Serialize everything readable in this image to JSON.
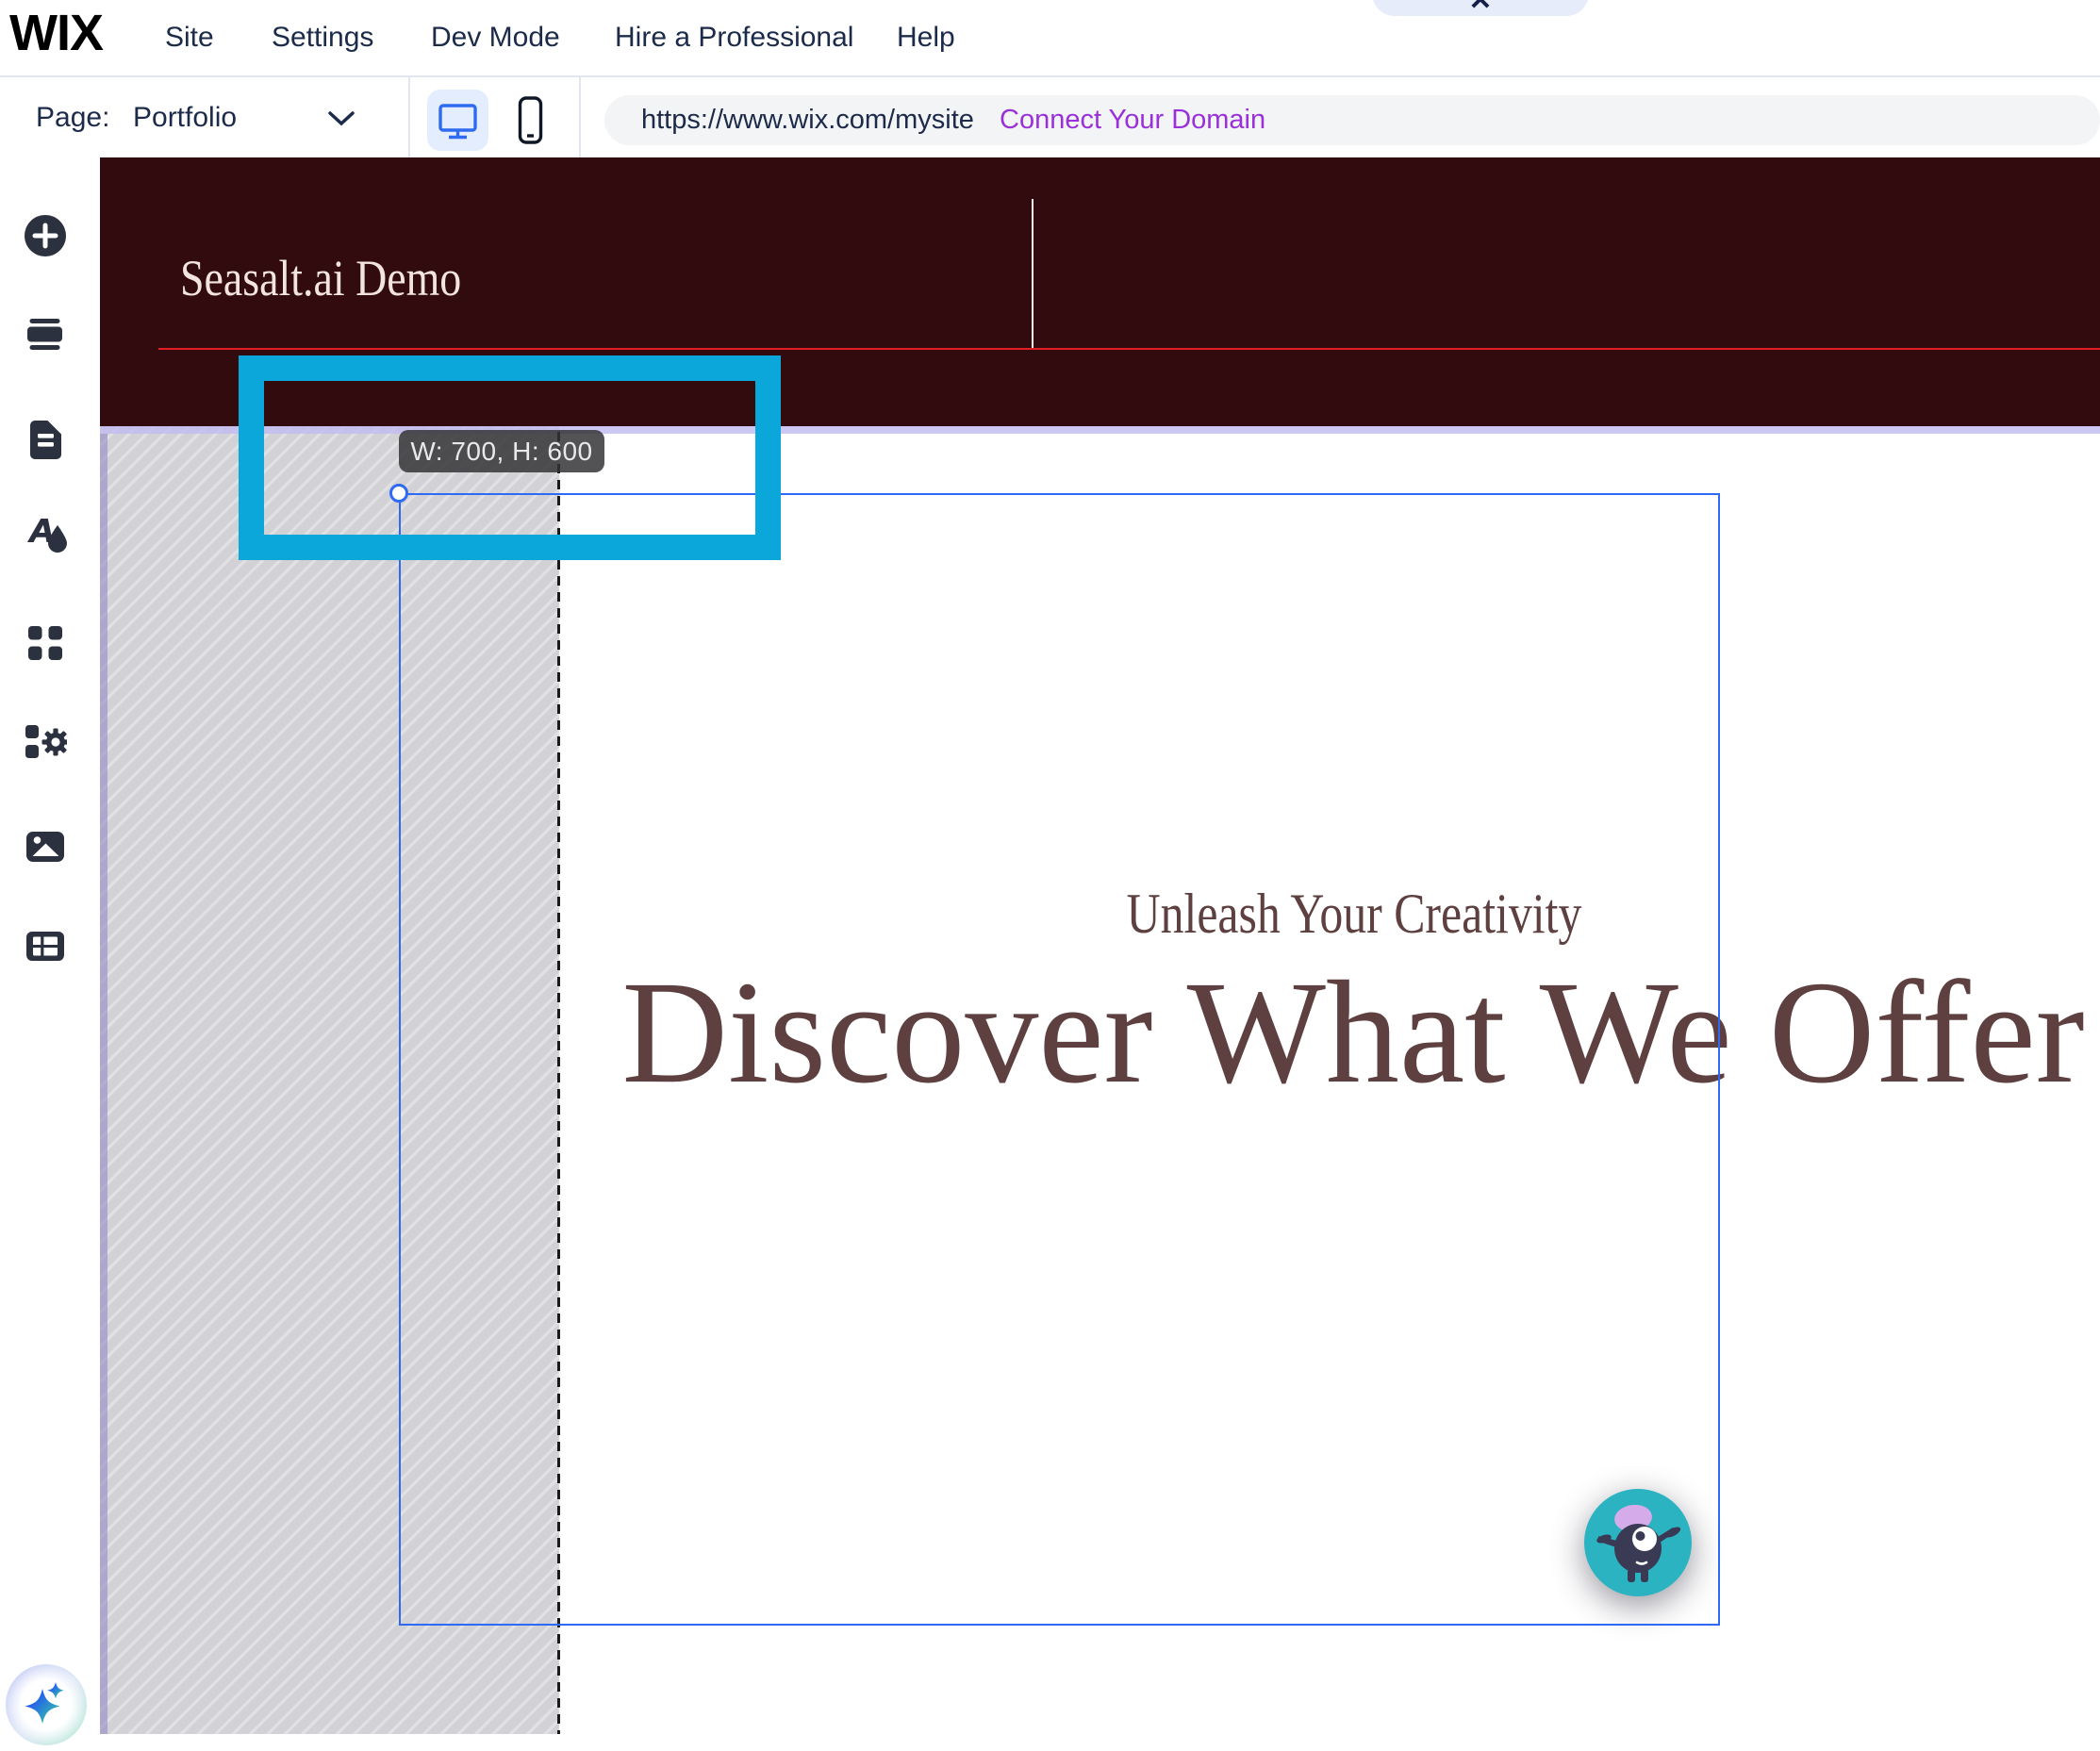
{
  "topbar": {
    "logo": "WIX",
    "menu": [
      {
        "label": "Site"
      },
      {
        "label": "Settings"
      },
      {
        "label": "Dev Mode"
      },
      {
        "label": "Hire a Professional"
      },
      {
        "label": "Help"
      }
    ],
    "dismiss_label": "✕"
  },
  "toolbar": {
    "page_label": "Page:",
    "page_value": "Portfolio",
    "url": "https://www.wix.com/mysite",
    "connect_label": "Connect Your Domain"
  },
  "sidebar": {
    "items": [
      {
        "icon": "add-icon"
      },
      {
        "icon": "add-section-icon"
      },
      {
        "icon": "pages-icon"
      },
      {
        "icon": "site-design-icon"
      },
      {
        "icon": "app-market-icon"
      },
      {
        "icon": "widgets-icon"
      },
      {
        "icon": "media-icon"
      },
      {
        "icon": "cms-icon"
      }
    ],
    "ai_button": "ai-assistant-icon"
  },
  "canvas": {
    "site_title": "Seasalt.ai Demo",
    "tagline": "Unleash Your Creativity",
    "heading": "Discover What We Offer"
  },
  "overlay": {
    "size_tooltip": "W: 700, H: 600"
  },
  "colors": {
    "header_maroon": "#310b0d",
    "header_red_line": "#e01e24",
    "annotation_cyan": "#0ba7da",
    "selection_blue": "#2e6af3",
    "section_purple": "#c1baf0",
    "connect_purple": "#9a30d9",
    "heading_brown": "#5e4040",
    "chat_teal": "#2bb3c2",
    "ui_navy": "#1c2b4a"
  }
}
